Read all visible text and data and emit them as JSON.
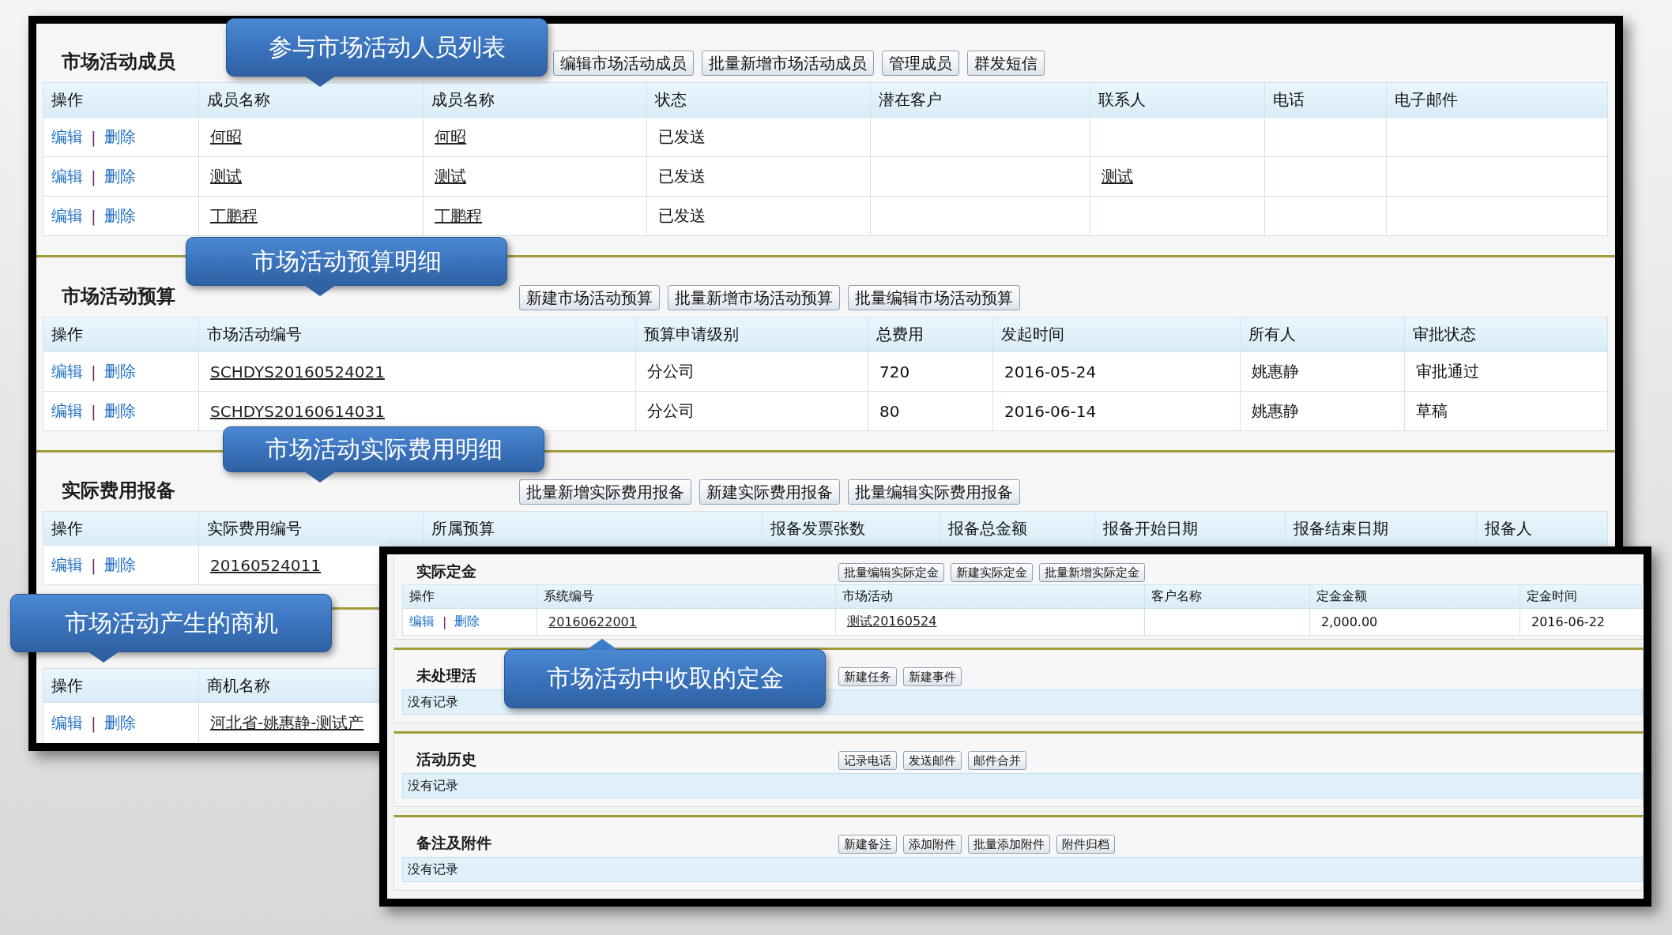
{
  "back_window": {
    "sections": [
      {
        "title": "市场活动成员",
        "buttons": [
          "编辑市场活动成员",
          "批量新增市场活动成员",
          "管理成员",
          "群发短信"
        ],
        "columns": [
          "操作",
          "成员名称",
          "成员名称",
          "状态",
          "潜在客户",
          "联系人",
          "电话",
          "电子邮件"
        ],
        "rows": [
          {
            "cells": [
              {
                "edit": "编辑",
                "sep": "|",
                "delete": "删除"
              },
              {
                "text": "何昭",
                "link": true
              },
              {
                "text": "何昭",
                "link": true
              },
              {
                "text": "已发送",
                "link": false
              },
              null,
              null,
              null,
              null
            ]
          },
          {
            "cells": [
              {
                "edit": "编辑",
                "sep": "|",
                "delete": "删除"
              },
              {
                "text": "测试",
                "link": true
              },
              {
                "text": "测试",
                "link": true
              },
              {
                "text": "已发送",
                "link": false
              },
              null,
              {
                "text": "测试",
                "link": true
              },
              null,
              null
            ]
          },
          {
            "cells": [
              {
                "edit": "编辑",
                "sep": "|",
                "delete": "删除"
              },
              {
                "text": "丁鹏程",
                "link": true
              },
              {
                "text": "丁鹏程",
                "link": true
              },
              {
                "text": "已发送",
                "link": false
              },
              null,
              null,
              null,
              null
            ]
          }
        ]
      },
      {
        "title": "市场活动预算",
        "buttons": [
          "新建市场活动预算",
          "批量新增市场活动预算",
          "批量编辑市场活动预算"
        ],
        "columns": [
          "操作",
          "市场活动编号",
          "预算申请级别",
          "总费用",
          "发起时间",
          "所有人",
          "审批状态"
        ],
        "rows": [
          {
            "cells": [
              {
                "edit": "编辑",
                "sep": "|",
                "delete": "删除"
              },
              {
                "text": "SCHDYS20160524021",
                "link": true
              },
              {
                "text": "分公司",
                "link": false
              },
              {
                "text": "720",
                "link": false
              },
              {
                "text": "2016-05-24",
                "link": false
              },
              {
                "text": "姚惠静",
                "link": false
              },
              {
                "text": "审批通过",
                "link": false
              }
            ]
          },
          {
            "cells": [
              {
                "edit": "编辑",
                "sep": "|",
                "delete": "删除"
              },
              {
                "text": "SCHDYS20160614031",
                "link": true
              },
              {
                "text": "分公司",
                "link": false
              },
              {
                "text": "80",
                "link": false
              },
              {
                "text": "2016-06-14",
                "link": false
              },
              {
                "text": "姚惠静",
                "link": false
              },
              {
                "text": "草稿",
                "link": false
              }
            ]
          }
        ]
      },
      {
        "title": "实际费用报备",
        "buttons": [
          "批量新增实际费用报备",
          "新建实际费用报备",
          "批量编辑实际费用报备"
        ],
        "columns": [
          "操作",
          "实际费用编号",
          "所属预算",
          "报备发票张数",
          "报备总金额",
          "报备开始日期",
          "报备结束日期",
          "报备人"
        ],
        "rows": [
          {
            "cells": [
              {
                "edit": "编辑",
                "sep": "|",
                "delete": "删除"
              },
              {
                "text": "20160524011",
                "link": true
              },
              null,
              null,
              null,
              null,
              null,
              null
            ]
          }
        ]
      },
      {
        "columns": [
          "操作",
          "商机名称"
        ],
        "rows": [
          {
            "cells": [
              {
                "edit": "编辑",
                "sep": "|",
                "delete": "删除"
              },
              {
                "text": "河北省-姚惠静-测试产",
                "link": true
              }
            ]
          }
        ]
      }
    ]
  },
  "front_window": {
    "sections": [
      {
        "title": "实际定金",
        "buttons": [
          "批量编辑实际定金",
          "新建实际定金",
          "批量新增实际定金"
        ],
        "columns": [
          "操作",
          "系统编号",
          "市场活动",
          "客户名称",
          "定金金额",
          "定金时间"
        ],
        "rows": [
          {
            "cells": [
              {
                "edit": "编辑",
                "sep": "|",
                "delete": "删除"
              },
              {
                "text": "20160622001",
                "link": true
              },
              {
                "text": "测试20160524",
                "link": true
              },
              null,
              {
                "text": "2,000.00",
                "link": false
              },
              {
                "text": "2016-06-22",
                "link": false
              }
            ]
          }
        ]
      },
      {
        "title": "未处理活",
        "buttons": [
          "新建任务",
          "新建事件"
        ],
        "empty_text": "没有记录"
      },
      {
        "title": "活动历史",
        "buttons": [
          "记录电话",
          "发送邮件",
          "邮件合并"
        ],
        "empty_text": "没有记录"
      },
      {
        "title": "备注及附件",
        "buttons": [
          "新建备注",
          "添加附件",
          "批量添加附件",
          "附件归档"
        ],
        "empty_text": "没有记录"
      }
    ]
  },
  "callouts": [
    {
      "text": "参与市场活动人员列表"
    },
    {
      "text": "市场活动预算明细"
    },
    {
      "text": "市场活动实际费用明细"
    },
    {
      "text": "市场活动产生的商机"
    },
    {
      "text": "市场活动中收取的定金"
    }
  ]
}
